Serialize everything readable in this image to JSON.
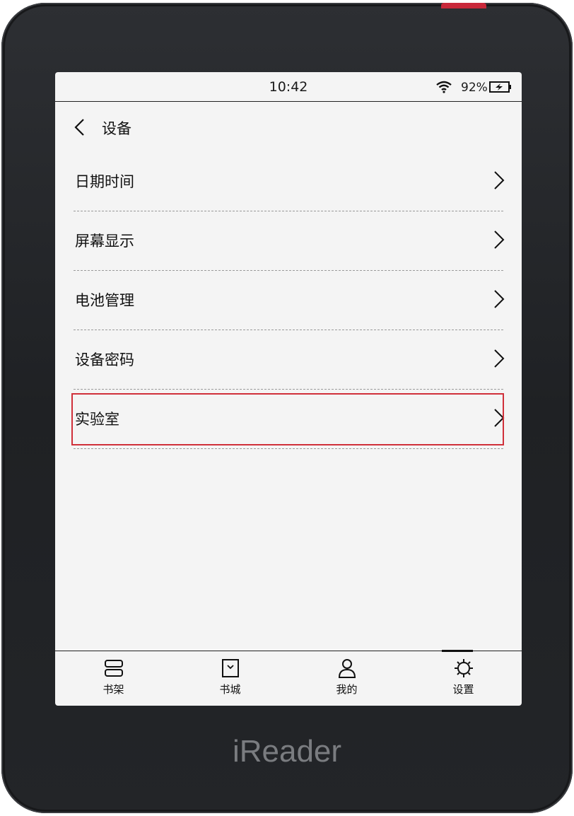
{
  "status_bar": {
    "time": "10:42",
    "battery_percent": "92%",
    "wifi_icon": "wifi-icon",
    "battery_icon": "battery-charging-icon"
  },
  "header": {
    "back_icon": "chevron-left-icon",
    "title": "设备"
  },
  "menu": {
    "items": [
      {
        "label": "日期时间"
      },
      {
        "label": "屏幕显示"
      },
      {
        "label": "电池管理"
      },
      {
        "label": "设备密码"
      },
      {
        "label": "实验室",
        "highlighted": true
      }
    ],
    "chevron_icon": "chevron-right-icon",
    "highlight_color": "#d0303a"
  },
  "tab_bar": {
    "tabs": [
      {
        "label": "书架",
        "icon": "bookshelf-icon"
      },
      {
        "label": "书城",
        "icon": "bookstore-icon"
      },
      {
        "label": "我的",
        "icon": "profile-icon"
      },
      {
        "label": "设置",
        "icon": "settings-icon",
        "active": true
      }
    ]
  },
  "device": {
    "brand": "iReader",
    "frame_color": "#222427",
    "power_button_color": "#c8283a"
  }
}
